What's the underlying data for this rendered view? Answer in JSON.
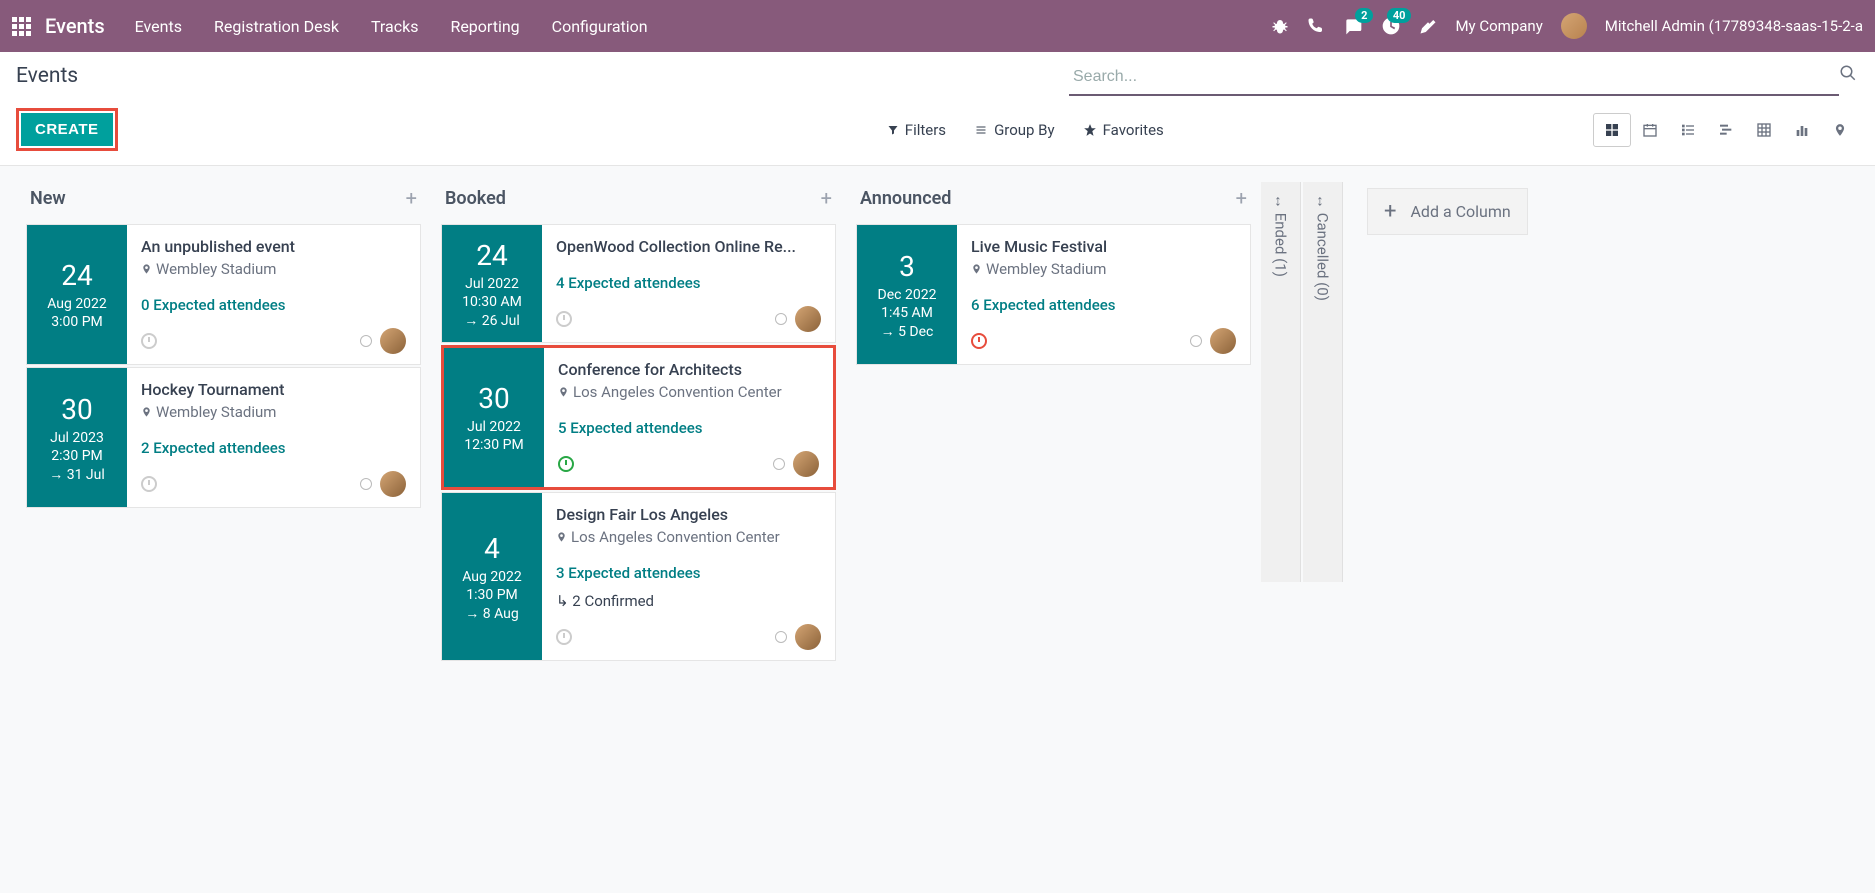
{
  "topbar": {
    "brand": "Events",
    "nav": [
      "Events",
      "Registration Desk",
      "Tracks",
      "Reporting",
      "Configuration"
    ],
    "chat_badge": "2",
    "activity_badge": "40",
    "company": "My Company",
    "user": "Mitchell Admin (17789348-saas-15-2-a"
  },
  "controlbar": {
    "title": "Events",
    "create": "CREATE",
    "search_placeholder": "Search...",
    "filters": "Filters",
    "groupby": "Group By",
    "favorites": "Favorites"
  },
  "columns": [
    {
      "title": "New",
      "cards": [
        {
          "day": "24",
          "month": "Aug 2022",
          "time": "3:00 PM",
          "end": "",
          "title": "An unpublished event",
          "location": "Wembley Stadium",
          "attendees": "0 Expected attendees",
          "confirmed": "",
          "clock": "grey",
          "highlight": false
        },
        {
          "day": "30",
          "month": "Jul 2023",
          "time": "2:30 PM",
          "end": "→ 31 Jul",
          "title": "Hockey Tournament",
          "location": "Wembley Stadium",
          "attendees": "2 Expected attendees",
          "confirmed": "",
          "clock": "grey",
          "highlight": false
        }
      ]
    },
    {
      "title": "Booked",
      "cards": [
        {
          "day": "24",
          "month": "Jul 2022",
          "time": "10:30 AM",
          "end": "→ 26 Jul",
          "title": "OpenWood Collection Online Re...",
          "location": "",
          "attendees": "4 Expected attendees",
          "confirmed": "",
          "clock": "grey",
          "highlight": false
        },
        {
          "day": "30",
          "month": "Jul 2022",
          "time": "12:30 PM",
          "end": "",
          "title": "Conference for Architects",
          "location": "Los Angeles Convention Center",
          "attendees": "5 Expected attendees",
          "confirmed": "",
          "clock": "green",
          "highlight": true
        },
        {
          "day": "4",
          "month": "Aug 2022",
          "time": "1:30 PM",
          "end": "→ 8 Aug",
          "title": "Design Fair Los Angeles",
          "location": "Los Angeles Convention Center",
          "attendees": "3 Expected attendees",
          "confirmed": "↳ 2 Confirmed",
          "clock": "grey",
          "highlight": false
        }
      ]
    },
    {
      "title": "Announced",
      "cards": [
        {
          "day": "3",
          "month": "Dec 2022",
          "time": "1:45 AM",
          "end": "→ 5 Dec",
          "title": "Live Music Festival",
          "location": "Wembley Stadium",
          "attendees": "6 Expected attendees",
          "confirmed": "",
          "clock": "red",
          "highlight": false
        }
      ]
    }
  ],
  "folded": [
    {
      "label": "Ended (1)"
    },
    {
      "label": "Cancelled (0)"
    }
  ],
  "add_column": "Add a Column"
}
